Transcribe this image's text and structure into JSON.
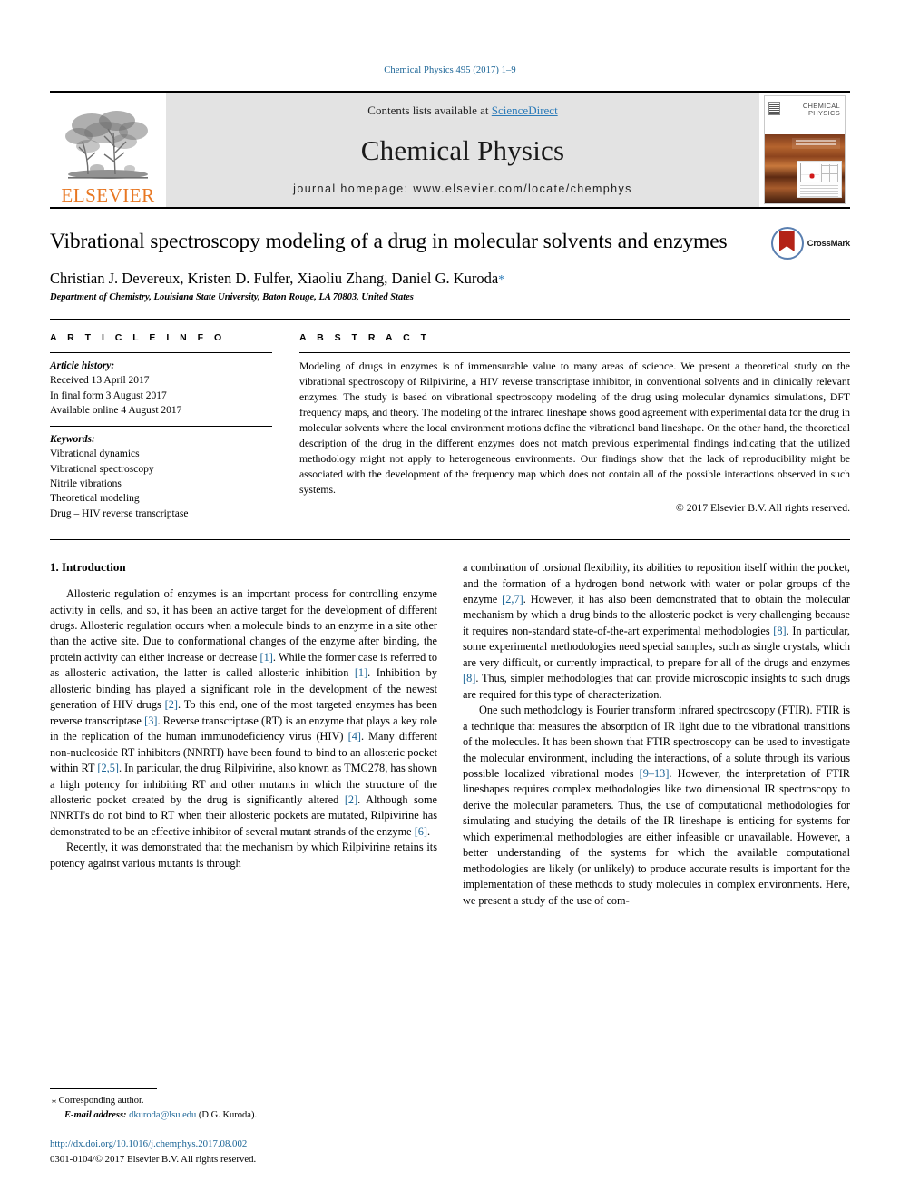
{
  "runhead": "Chemical Physics 495 (2017) 1–9",
  "masthead": {
    "publisher": "ELSEVIER",
    "contents_prefix": "Contents lists available at ",
    "contents_link": "ScienceDirect",
    "journal_title": "Chemical Physics",
    "homepage": "journal homepage: www.elsevier.com/locate/chemphys",
    "cover_name_line1": "CHEMICAL",
    "cover_name_line2": "PHYSICS"
  },
  "title": "Vibrational spectroscopy modeling of a drug in molecular solvents and enzymes",
  "crossmark_label": "CrossMark",
  "authors": "Christian J. Devereux, Kristen D. Fulfer, Xiaoliu Zhang, Daniel G. Kuroda",
  "author_star": "*",
  "affiliation": "Department of Chemistry, Louisiana State University, Baton Rouge, LA 70803, United States",
  "article_info": {
    "label": "A R T I C L E   I N F O",
    "history_label": "Article history:",
    "history": [
      "Received 13 April 2017",
      "In final form 3 August 2017",
      "Available online 4 August 2017"
    ],
    "keywords_label": "Keywords:",
    "keywords": [
      "Vibrational dynamics",
      "Vibrational spectroscopy",
      "Nitrile vibrations",
      "Theoretical modeling",
      "Drug – HIV reverse transcriptase"
    ]
  },
  "abstract": {
    "label": "A B S T R A C T",
    "text": "Modeling of drugs in enzymes is of immensurable value to many areas of science. We present a theoretical study on the vibrational spectroscopy of Rilpivirine, a HIV reverse transcriptase inhibitor, in conventional solvents and in clinically relevant enzymes. The study is based on vibrational spectroscopy modeling of the drug using molecular dynamics simulations, DFT frequency maps, and theory. The modeling of the infrared lineshape shows good agreement with experimental data for the drug in molecular solvents where the local environment motions define the vibrational band lineshape. On the other hand, the theoretical description of the drug in the different enzymes does not match previous experimental findings indicating that the utilized methodology might not apply to heterogeneous environments. Our findings show that the lack of reproducibility might be associated with the development of the frequency map which does not contain all of the possible interactions observed in such systems.",
    "copyright": "© 2017 Elsevier B.V. All rights reserved."
  },
  "body": {
    "section_heading": "1. Introduction",
    "left_paragraphs": [
      "Allosteric regulation of enzymes is an important process for controlling enzyme activity in cells, and so, it has been an active target for the development of different drugs. Allosteric regulation occurs when a molecule binds to an enzyme in a site other than the active site. Due to conformational changes of the enzyme after binding, the protein activity can either increase or decrease [1]. While the former case is referred to as allosteric activation, the latter is called allosteric inhibition [1]. Inhibition by allosteric binding has played a significant role in the development of the newest generation of HIV drugs [2]. To this end, one of the most targeted enzymes has been reverse transcriptase [3]. Reverse transcriptase (RT) is an enzyme that plays a key role in the replication of the human immunodeficiency virus (HIV) [4]. Many different non-nucleoside RT inhibitors (NNRTI) have been found to bind to an allosteric pocket within RT [2,5]. In particular, the drug Rilpivirine, also known as TMC278, has shown a high potency for inhibiting RT and other mutants in which the structure of the allosteric pocket created by the drug is significantly altered [2]. Although some NNRTI's do not bind to RT when their allosteric pockets are mutated, Rilpivirine has demonstrated to be an effective inhibitor of several mutant strands of the enzyme [6].",
      "Recently, it was demonstrated that the mechanism by which Rilpivirine retains its potency against various mutants is through"
    ],
    "right_paragraphs": [
      "a combination of torsional flexibility, its abilities to reposition itself within the pocket, and the formation of a hydrogen bond network with water or polar groups of the enzyme [2,7]. However, it has also been demonstrated that to obtain the molecular mechanism by which a drug binds to the allosteric pocket is very challenging because it requires non-standard state-of-the-art experimental methodologies [8]. In particular, some experimental methodologies need special samples, such as single crystals, which are very difficult, or currently impractical, to prepare for all of the drugs and enzymes [8]. Thus, simpler methodologies that can provide microscopic insights to such drugs are required for this type of characterization.",
      "One such methodology is Fourier transform infrared spectroscopy (FTIR). FTIR is a technique that measures the absorption of IR light due to the vibrational transitions of the molecules. It has been shown that FTIR spectroscopy can be used to investigate the molecular environment, including the interactions, of a solute through its various possible localized vibrational modes [9–13]. However, the interpretation of FTIR lineshapes requires complex methodologies like two dimensional IR spectroscopy to derive the molecular parameters. Thus, the use of computational methodologies for simulating and studying the details of the IR lineshape is enticing for systems for which experimental methodologies are either infeasible or unavailable. However, a better understanding of the systems for which the available computational methodologies are likely (or unlikely) to produce accurate results is important for the implementation of these methods to study molecules in complex environments. Here, we present a study of the use of com-"
    ]
  },
  "footnote": {
    "corresponding": "Corresponding author.",
    "star": "⁎",
    "email_label": "E-mail address:",
    "email": "dkuroda@lsu.edu",
    "email_suffix": " (D.G. Kuroda).",
    "doi": "http://dx.doi.org/10.1016/j.chemphys.2017.08.002",
    "issn": "0301-0104/© 2017 Elsevier B.V. All rights reserved."
  },
  "colors": {
    "link": "#1a6496",
    "ref": "#1a6496",
    "elsevier_orange": "#E87722",
    "masthead_bg": "#e3e3e3"
  }
}
